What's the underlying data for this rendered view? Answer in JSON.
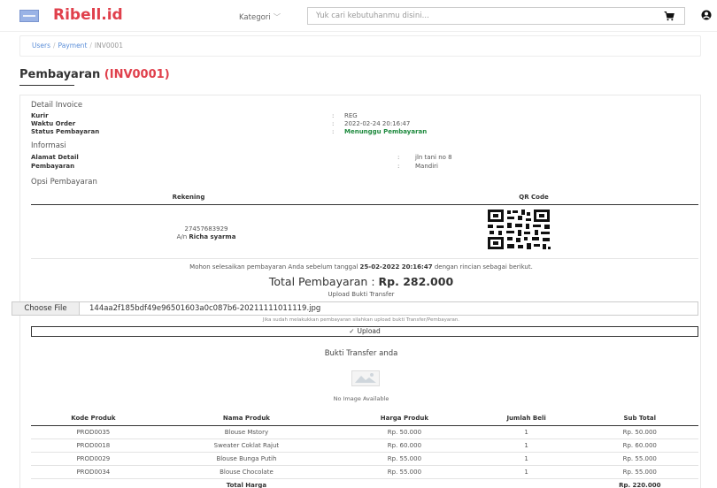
{
  "header": {
    "brand": "Ribell.id",
    "kategori_label": "Kategori",
    "search_placeholder": "Yuk cari kebutuhanmu disini..."
  },
  "breadcrumb": [
    "Users",
    "Payment",
    "INV0001"
  ],
  "page": {
    "title": "Pembayaran",
    "invoice_code": "(INV0001)"
  },
  "detail_invoice": {
    "heading": "Detail Invoice",
    "rows": [
      {
        "label": "Kurir",
        "value": "REG"
      },
      {
        "label": "Waktu Order",
        "value": "2022-02-24 20:16:47"
      },
      {
        "label": "Status Pembayaran",
        "value": "Menunggu Pembayaran"
      }
    ]
  },
  "informasi": {
    "heading": "Informasi",
    "rows": [
      {
        "label": "Alamat Detail",
        "value": "jln tani no 8"
      },
      {
        "label": "Pembayaran",
        "value": "Mandiri"
      }
    ]
  },
  "opsi_pembayaran": {
    "heading": "Opsi Pembayaran",
    "col_rekening": "Rekening",
    "col_qr": "QR Code",
    "account_number": "27457683929",
    "account_name_prefix": "A/n",
    "account_name": "Richa syarma"
  },
  "notice": {
    "before": "Mohon selesaikan pembayaran Anda sebelum tanggal",
    "deadline": "25-02-2022 20:16:47",
    "after": "dengan rincian sebagai berikut."
  },
  "total": {
    "label": "Total Pembayaran :",
    "amount": "Rp. 282.000"
  },
  "upload": {
    "caption": "Upload Bukti Transfer",
    "choose_label": "Choose File",
    "file_name": "144aa2f185bdf49e96501603a0c087b6-20211111011119.jpg",
    "hint": "Jika sudah melakukkan pembayaran silahkan upload bukti Transfer/Pembayaran.",
    "button": "Upload"
  },
  "bukti": {
    "title": "Bukti Transfer anda",
    "no_image": "No Image Available"
  },
  "products": {
    "headers": [
      "Kode Produk",
      "Nama Produk",
      "Harga Produk",
      "Jumlah Beli",
      "Sub Total"
    ],
    "rows": [
      [
        "PROD0035",
        "Blouse Mstory",
        "Rp. 50.000",
        "1",
        "Rp. 50.000"
      ],
      [
        "PROD0018",
        "Sweater Coklat Rajut",
        "Rp. 60.000",
        "1",
        "Rp. 60.000"
      ],
      [
        "PROD0029",
        "Blouse Bunga Putih",
        "Rp. 55.000",
        "1",
        "Rp. 55.000"
      ],
      [
        "PROD0034",
        "Blouse Chocolate",
        "Rp. 55.000",
        "1",
        "Rp. 55.000"
      ]
    ],
    "total_label": "Total Harga",
    "total_value": "Rp. 220.000"
  },
  "colors": {
    "brand": "#e0404c",
    "status_green": "#1e8a3e",
    "link": "#5b8ed8"
  }
}
